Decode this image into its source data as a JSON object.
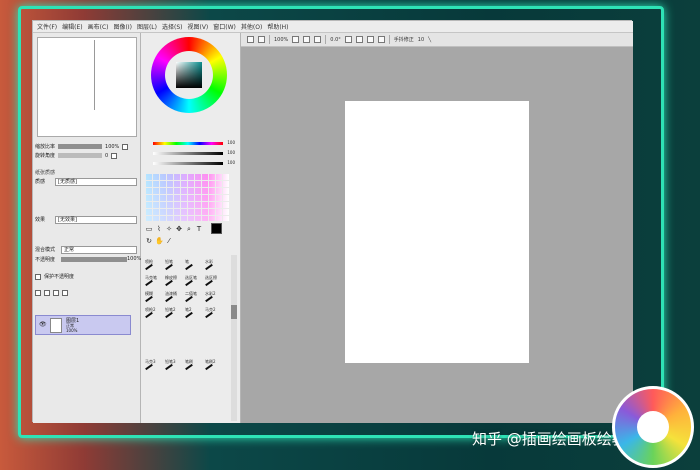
{
  "menubar": {
    "items": [
      "文件(F)",
      "编辑(E)",
      "画布(C)",
      "图像(I)",
      "图层(L)",
      "选择(S)",
      "视图(V)",
      "窗口(W)",
      "其他(O)",
      "帮助(H)"
    ]
  },
  "toolbar": {
    "zoom": "100%",
    "rotate": "0.0°",
    "stabilizer_label": "手抖修正",
    "stabilizer_value": "10"
  },
  "left_panel": {
    "zoom_label": "缩放比率",
    "zoom_value": "100%",
    "rotate_label": "旋转角度",
    "rotate_value": "0",
    "effects_head": "纸张质感",
    "texture_label": "质感",
    "texture_value": "[无质感]",
    "effect_label": "效果",
    "effect_value": "[无效果]",
    "blend_label": "混合模式",
    "blend_value": "正常",
    "opacity_label": "不透明度",
    "opacity_value": "100%",
    "protect_label": "保护不透明度",
    "layer_name": "图层1",
    "layer_mode": "正常",
    "layer_opacity": "100%"
  },
  "color_panel": {
    "slider_values": [
      "100",
      "100",
      "100"
    ],
    "fg_color": "#000000"
  },
  "tool_panel": {
    "tools": [
      "喷枪",
      "铅笔",
      "笔",
      "水彩",
      "马克笔",
      "橡皮擦",
      "选区笔",
      "选区擦",
      "模糊",
      "油漆桶",
      "二值笔",
      "水彩2",
      "喷枪2",
      "铅笔2",
      "笔2",
      "马克2",
      "马克3",
      "铅笔3",
      "笔刷",
      "笔刷2"
    ]
  },
  "watermark": {
    "text": "知乎 @插画绘画板绘教程"
  },
  "colors": {
    "accent_glow": "#2ee3b6",
    "canvas_bg": "#a7a7a7",
    "paper": "#ffffff",
    "selected_layer": "#c9c9f0"
  }
}
